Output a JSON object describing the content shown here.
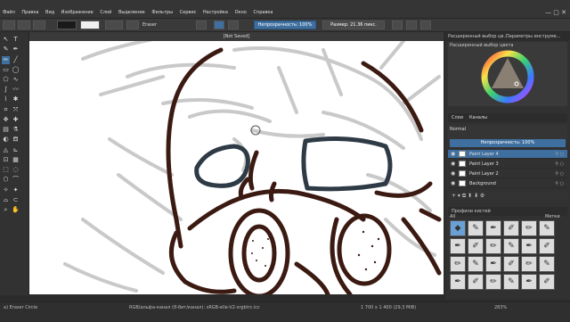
{
  "menu": [
    "Файл",
    "Правка",
    "Вид",
    "Изображение",
    "Слой",
    "Выделение",
    "Фильтры",
    "Сервис",
    "Настройка",
    "Окно",
    "Справка"
  ],
  "options": {
    "preset_name": "Eraser",
    "opacity_label": "Непрозрачность: 100%",
    "size_label": "Размер: 21.36 пикс."
  },
  "document": {
    "title": "[Not Saved]"
  },
  "dock": {
    "tab_advanced_color": "Расширенный выбор цв...",
    "tab_brush_settings": "Параметры инструме...",
    "selector_title": "Расширенный выбор цвета"
  },
  "layers": {
    "tabs": [
      "Слои",
      "Каналы"
    ],
    "blend_mode": "Normal",
    "opacity": "Непрозрачность: 100%",
    "items": [
      {
        "name": "Paint Layer 4",
        "selected": true
      },
      {
        "name": "Paint Layer 3",
        "selected": false
      },
      {
        "name": "Paint Layer 2",
        "selected": false
      },
      {
        "name": "Background",
        "selected": false
      }
    ]
  },
  "brushes": {
    "title": "Профили кистей",
    "filter": "All",
    "tag_label": "Метки"
  },
  "status": {
    "tool": "a) Eraser Circle",
    "colorspace": "RGB/альфа-канал (8-бит/канал): sRGB-elle-V2-srgbtrc.icc",
    "dimensions": "1 700 x 1 400 (29,3 MiB)",
    "zoom": "283%"
  },
  "colors": {
    "accent": "#3e6f9f",
    "stroke_brown": "#3b1a12",
    "stroke_gray": "#2e3a45",
    "sketch": "#c9c9c9"
  }
}
